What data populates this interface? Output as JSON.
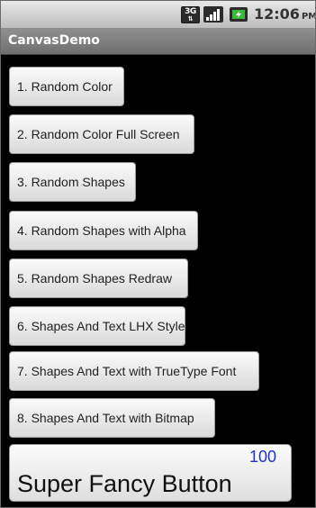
{
  "status_bar": {
    "network_icon": "3g-data-icon",
    "network_label": "3G",
    "signal_icon": "signal-strength-icon",
    "battery_icon": "battery-charging-icon",
    "time": "12:06",
    "ampm": "PM"
  },
  "app": {
    "title": "CanvasDemo"
  },
  "buttons": [
    {
      "label": "1. Random Color"
    },
    {
      "label": "2. Random Color Full Screen"
    },
    {
      "label": "3. Random Shapes"
    },
    {
      "label": "4. Random Shapes with Alpha"
    },
    {
      "label": "5. Random Shapes Redraw"
    },
    {
      "label": "6. Shapes And Text LHX Style"
    },
    {
      "label": "7. Shapes And Text with TrueType Font"
    },
    {
      "label": "8. Shapes And Text with Bitmap"
    }
  ],
  "fancy_button": {
    "label": "Super Fancy Button",
    "count": "100"
  },
  "colors": {
    "background": "#000000",
    "status_bar": "#d2d2d2",
    "title_bar": "#7f7f7f",
    "button_face": "#e6e6e6",
    "count_text": "#2233cc",
    "battery_accent": "#3cb83c"
  }
}
